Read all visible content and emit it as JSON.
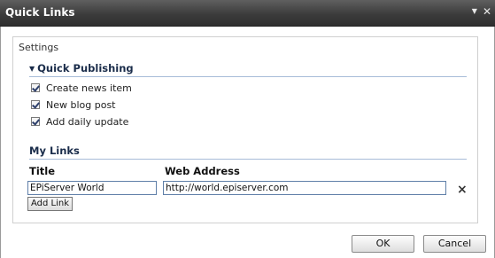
{
  "window": {
    "title": "Quick Links"
  },
  "settings": {
    "legend": "Settings",
    "quick_publishing": {
      "heading": "Quick Publishing",
      "items": [
        {
          "label": "Create news item",
          "checked": true
        },
        {
          "label": "New blog post",
          "checked": true
        },
        {
          "label": "Add daily update",
          "checked": true
        }
      ]
    },
    "my_links": {
      "heading": "My Links",
      "title_header": "Title",
      "address_header": "Web Address",
      "rows": [
        {
          "title": "EPiServer World",
          "address": "http://world.episerver.com"
        }
      ],
      "add_label": "Add Link",
      "remove_symbol": "×"
    }
  },
  "buttons": {
    "ok": "OK",
    "cancel": "Cancel"
  }
}
